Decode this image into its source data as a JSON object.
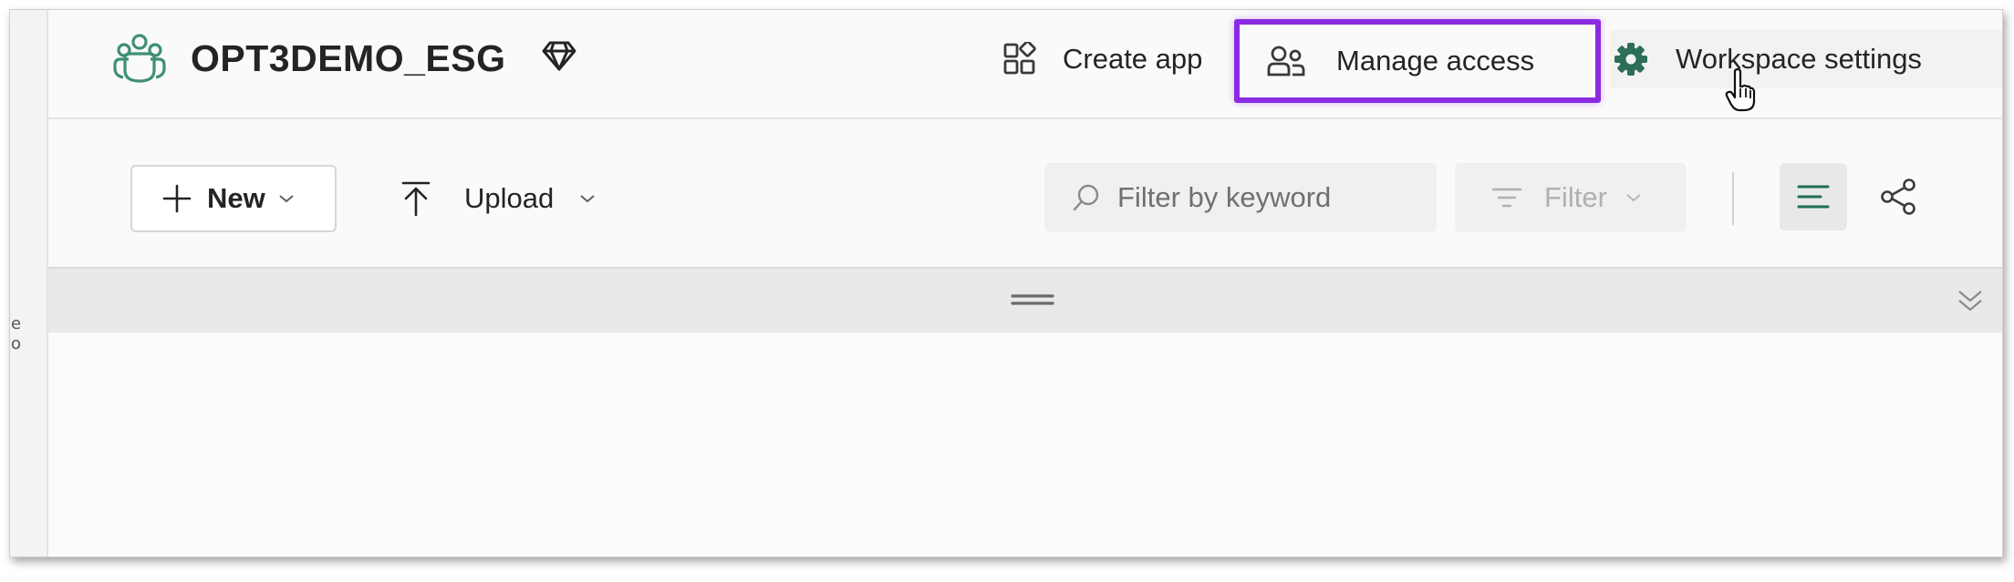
{
  "header": {
    "workspace_title": "OPT3DEMO_ESG",
    "create_app_label": "Create app",
    "manage_access_label": "Manage access",
    "workspace_settings_label": "Workspace settings"
  },
  "toolbar": {
    "new_label": "New",
    "upload_label": "Upload",
    "filter_label": "Filter",
    "search": {
      "placeholder": "Filter by keyword",
      "value": ""
    }
  },
  "left_rail": {
    "glyphs": [
      "e",
      "o"
    ]
  },
  "icons": {
    "workspace": "workspace-people-icon",
    "premium": "diamond-icon",
    "create_app": "apps-icon",
    "manage_access": "people-icon",
    "workspace_settings": "gear-icon",
    "cursor": "hand-pointer-icon",
    "new": "plus-icon",
    "upload": "arrow-upload-icon",
    "search": "search-icon",
    "filter": "filter-icon",
    "list_view": "list-view-icon",
    "lineage_view": "lineage-icon",
    "drag_handle": "drag-handle-icon",
    "collapse": "chevron-double-down-icon"
  },
  "colors": {
    "highlight": "#8a2be2",
    "gear": "#2c6e57",
    "workspace_icon": "#3f8f78",
    "list_icon": "#1f6e58"
  }
}
